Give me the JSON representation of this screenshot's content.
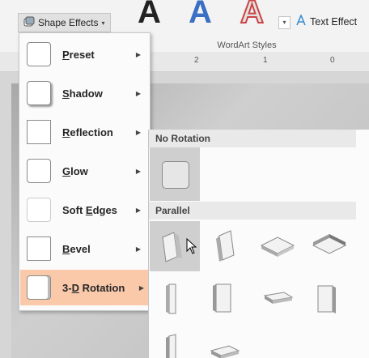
{
  "ribbon": {
    "shape_effects_label": "Shape Effects",
    "text_effects_label": "Text Effect",
    "group_label": "WordArt Styles",
    "wordart_glyph": "A"
  },
  "ruler": {
    "marks": [
      "2",
      "1",
      "0"
    ]
  },
  "menu": {
    "items": [
      {
        "accel": "P",
        "rest": "reset",
        "pre": ""
      },
      {
        "accel": "S",
        "rest": "hadow",
        "pre": ""
      },
      {
        "accel": "R",
        "rest": "eflection",
        "pre": ""
      },
      {
        "accel": "G",
        "rest": "low",
        "pre": ""
      },
      {
        "accel": "E",
        "rest": "dges",
        "pre": "Soft "
      },
      {
        "accel": "B",
        "rest": "evel",
        "pre": ""
      },
      {
        "accel": "D",
        "rest": " Rotation",
        "pre": "3-"
      }
    ]
  },
  "gallery": {
    "no_rotation_header": "No Rotation",
    "parallel_header": "Parallel"
  },
  "colors": {
    "active_item": "#f9c9aa",
    "selected_cell": "#cfcfcf"
  },
  "icons": [
    "shape-effects-icon",
    "chevron-down-icon",
    "text-effects-icon",
    "submenu-arrow-icon",
    "mouse-pointer-icon"
  ]
}
